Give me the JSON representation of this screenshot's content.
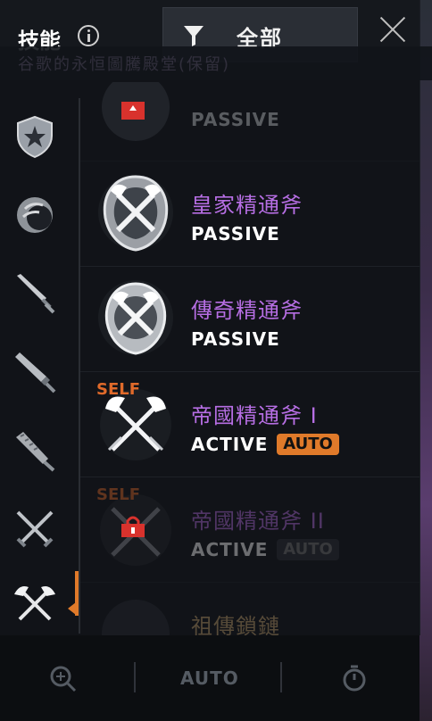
{
  "header": {
    "title": "技能",
    "filter_label": "全部"
  },
  "background": {
    "faded_banner_text": "谷歌的永恒圖騰殿堂(保留)"
  },
  "sidebar": {
    "items": [
      {
        "icon": "shield-star-icon"
      },
      {
        "icon": "orb-icon"
      },
      {
        "icon": "sword-icon"
      },
      {
        "icon": "broadsword-icon"
      },
      {
        "icon": "club-icon"
      },
      {
        "icon": "crossed-swords-icon"
      },
      {
        "icon": "crossed-axes-icon",
        "selected": true
      }
    ]
  },
  "skills": [
    {
      "name": "",
      "type": "PASSIVE",
      "locked": true,
      "faded": true
    },
    {
      "name": "皇家精通斧",
      "type": "PASSIVE",
      "locked": false,
      "faded": false
    },
    {
      "name": "傳奇精通斧",
      "type": "PASSIVE",
      "locked": false,
      "faded": false
    },
    {
      "name": "帝國精通斧 I",
      "type": "ACTIVE",
      "auto": "AUTO",
      "self": "SELF",
      "locked": false,
      "faded": false
    },
    {
      "name": "帝國精通斧 II",
      "type": "ACTIVE",
      "auto": "AUTO",
      "self": "SELF",
      "locked": true,
      "faded": true
    },
    {
      "name": "祖傳鎖鏈",
      "type": "",
      "locked": false,
      "faded": true
    }
  ],
  "footer": {
    "auto_label": "AUTO"
  },
  "colors": {
    "accent": "#e07a2a",
    "skill_name": "#b66ee3",
    "lock": "#d8322d"
  }
}
